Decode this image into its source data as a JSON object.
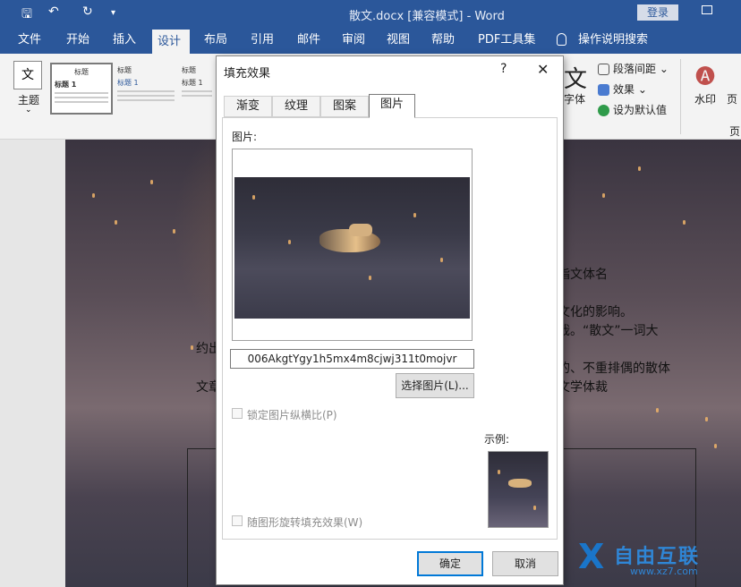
{
  "titlebar": {
    "save_icon": "save-icon",
    "undo_icon": "undo-icon",
    "redo_icon": "redo-icon",
    "customize_icon": "customize-quick-access-icon",
    "title": "散文.docx [兼容模式]  -  Word",
    "login": "登录"
  },
  "tabs": [
    "文件",
    "开始",
    "插入",
    "设计",
    "布局",
    "引用",
    "邮件",
    "审阅",
    "视图",
    "帮助",
    "PDF工具集",
    "操作说明搜索"
  ],
  "ribbon": {
    "theme_label": "主题",
    "theme_icon_text": "文",
    "gallery": [
      {
        "title": "标题",
        "heading": "标题 1"
      },
      {
        "title": "标题",
        "heading": "标题 1"
      },
      {
        "title": "标题",
        "heading": "标题 1"
      }
    ],
    "font_label": "字体",
    "paragraph_spacing": "段落间距",
    "effects": "效果",
    "set_default": "设为默认值",
    "watermark": "水印",
    "page_color": "页",
    "page_borders_partial": "页"
  },
  "document": {
    "lines": [
      "指文体名",
      "文化的影响。",
      "哉。“散文”一词大",
      "约出",
      "的、不重排偶的散体",
      "文章",
      "文学体裁"
    ]
  },
  "dialog": {
    "title": "填充效果",
    "help": "?",
    "close": "✕",
    "tabs": [
      "渐变",
      "纹理",
      "图案",
      "图片"
    ],
    "active_tab": "图片",
    "picture_label": "图片:",
    "picture_name": "006AkgtYgy1h5mx4m8cjwj311t0mojvr",
    "select_button": "选择图片(L)...",
    "lock_aspect": "锁定图片纵横比(P)",
    "rotate_with_shape": "随图形旋转填充效果(W)",
    "sample_label": "示例:",
    "ok": "确定",
    "cancel": "取消"
  },
  "watermark": {
    "brand_x": "X",
    "brand_cn": "自由互联",
    "url": "www.xz7.com"
  }
}
